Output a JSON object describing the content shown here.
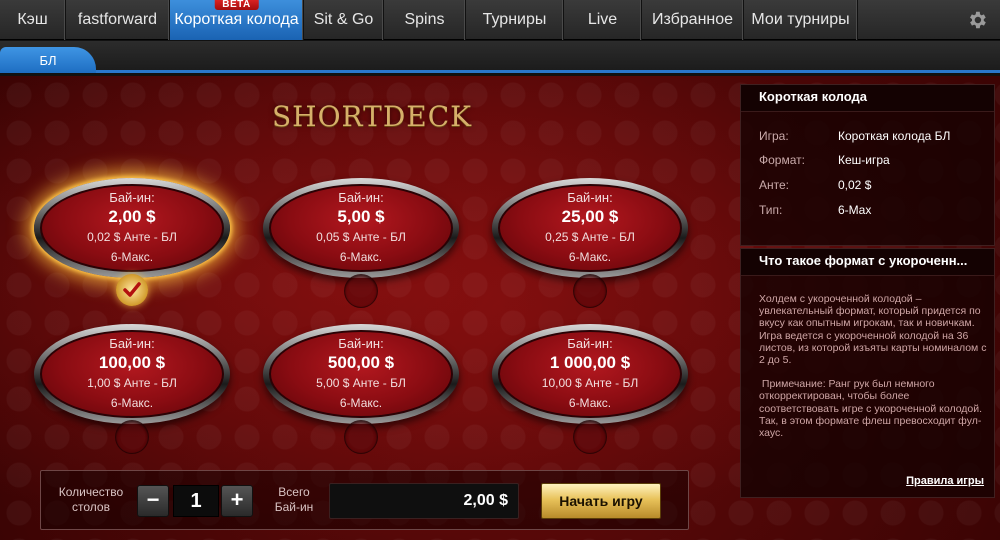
{
  "tabs": [
    {
      "label": "Кэш",
      "name": "tab-cash"
    },
    {
      "label": "fastforward",
      "name": "tab-fastforward"
    },
    {
      "label": "Короткая колода",
      "name": "tab-short-deck",
      "badge": "BETA"
    },
    {
      "label": "Sit & Go",
      "name": "tab-sit-and-go"
    },
    {
      "label": "Spins",
      "name": "tab-spins"
    },
    {
      "label": "Турниры",
      "name": "tab-tournaments"
    },
    {
      "label": "Live",
      "name": "tab-live"
    },
    {
      "label": "Избранное",
      "name": "tab-favorites"
    },
    {
      "label": "Мои турниры",
      "name": "tab-my-tournaments"
    }
  ],
  "settings_icon": "gear-icon",
  "subtab": {
    "label": "БЛ"
  },
  "logo": {
    "text": "SHORTDECK"
  },
  "tables": [
    {
      "buyin_label": "Бай-ин:",
      "amount": "2,00 $",
      "ante": "0,02 $ Анте - БЛ",
      "max": "6-Макс.",
      "selected": true
    },
    {
      "buyin_label": "Бай-ин:",
      "amount": "5,00 $",
      "ante": "0,05 $ Анте - БЛ",
      "max": "6-Макс.",
      "selected": false
    },
    {
      "buyin_label": "Бай-ин:",
      "amount": "25,00 $",
      "ante": "0,25 $ Анте - БЛ",
      "max": "6-Макс.",
      "selected": false
    },
    {
      "buyin_label": "Бай-ин:",
      "amount": "100,00 $",
      "ante": "1,00 $ Анте - БЛ",
      "max": "6-Макс.",
      "selected": false
    },
    {
      "buyin_label": "Бай-ин:",
      "amount": "500,00 $",
      "ante": "5,00 $ Анте - БЛ",
      "max": "6-Макс.",
      "selected": false
    },
    {
      "buyin_label": "Бай-ин:",
      "amount": "1 000,00 $",
      "ante": "10,00 $ Анте - БЛ",
      "max": "6-Макс.",
      "selected": false
    }
  ],
  "controls": {
    "tables_count_label_1": "Количество",
    "tables_count_label_2": "столов",
    "minus": "−",
    "plus": "+",
    "quantity": "1",
    "total_label_1": "Всего",
    "total_label_2": "Бай-ин",
    "total_value": "2,00 $",
    "start_button": "Начать игру"
  },
  "info": {
    "title": "Короткая колода",
    "rows": [
      {
        "key": "Игра:",
        "value": "Короткая колода БЛ"
      },
      {
        "key": "Формат:",
        "value": "Кеш-игра"
      },
      {
        "key": "Анте:",
        "value": "0,02 $"
      },
      {
        "key": "Тип:",
        "value": "6-Max"
      }
    ]
  },
  "what": {
    "title": "Что такое формат с укороченн...",
    "para1": "Холдем с укороченной колодой – увлекательный формат, который придется по вкусу как опытным игрокам, так и новичкам. Игра ведется с укороченной колодой на 36 листов, из которой изъяты карты номиналом с 2 до 5.",
    "para2": " Примечание: Ранг рук был немного откорректирован, чтобы более соответствовать игре с укороченной колодой. Так, в этом формате флеш превосходит фул-хаус.",
    "rules_link": "Правила игры"
  }
}
